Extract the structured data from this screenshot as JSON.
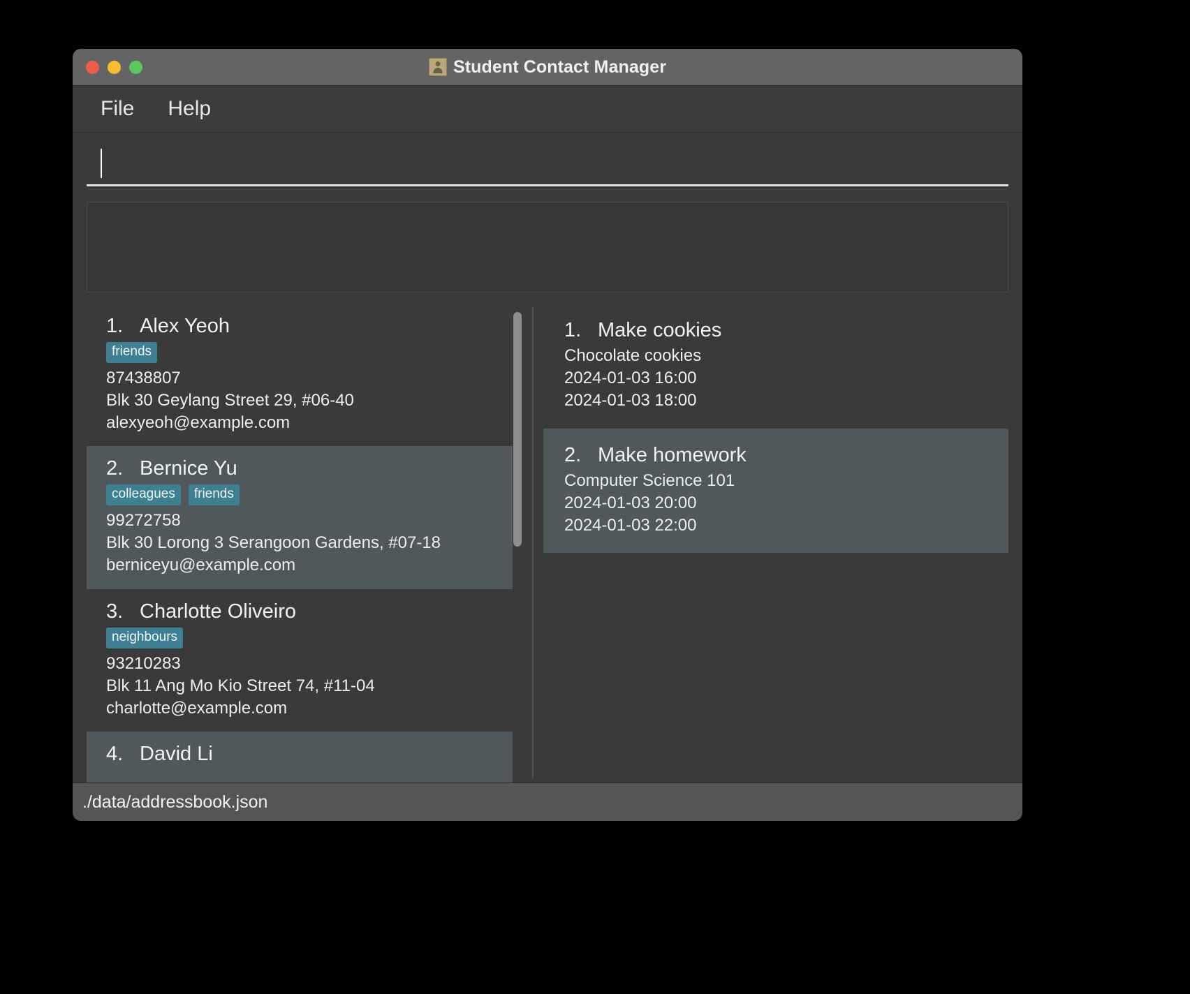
{
  "window": {
    "title": "Student Contact Manager",
    "icon": "contact-card-icon",
    "traffic_lights": [
      "close",
      "minimize",
      "zoom"
    ]
  },
  "menubar": {
    "items": [
      {
        "label": "File"
      },
      {
        "label": "Help"
      }
    ]
  },
  "command_box": {
    "value": "",
    "placeholder": ""
  },
  "result_display": {
    "text": ""
  },
  "person_list": {
    "items": [
      {
        "index": "1.",
        "name": "Alex Yeoh",
        "tags": [
          "friends"
        ],
        "phone": "87438807",
        "address": "Blk 30 Geylang Street 29, #06-40",
        "email": "alexyeoh@example.com",
        "selected": false
      },
      {
        "index": "2.",
        "name": "Bernice Yu",
        "tags": [
          "colleagues",
          "friends"
        ],
        "phone": "99272758",
        "address": "Blk 30 Lorong 3 Serangoon Gardens, #07-18",
        "email": "berniceyu@example.com",
        "selected": true
      },
      {
        "index": "3.",
        "name": "Charlotte Oliveiro",
        "tags": [
          "neighbours"
        ],
        "phone": "93210283",
        "address": "Blk 11 Ang Mo Kio Street 74, #11-04",
        "email": "charlotte@example.com",
        "selected": false
      },
      {
        "index": "4.",
        "name": "David Li",
        "tags": [],
        "phone": "",
        "address": "",
        "email": "",
        "selected": true
      }
    ]
  },
  "task_list": {
    "items": [
      {
        "index": "1.",
        "title": "Make cookies",
        "description": "Chocolate cookies",
        "start": "2024-01-03 16:00",
        "end": "2024-01-03 18:00",
        "selected": false
      },
      {
        "index": "2.",
        "title": "Make homework",
        "description": "Computer Science 101",
        "start": "2024-01-03 20:00",
        "end": "2024-01-03 22:00",
        "selected": true
      }
    ]
  },
  "statusbar": {
    "path": "./data/addressbook.json"
  },
  "colors": {
    "tag_badge": "#3e7f92",
    "selected_card": "#50585b",
    "window_chrome": "#646464",
    "body_background": "#3a3a3a"
  }
}
